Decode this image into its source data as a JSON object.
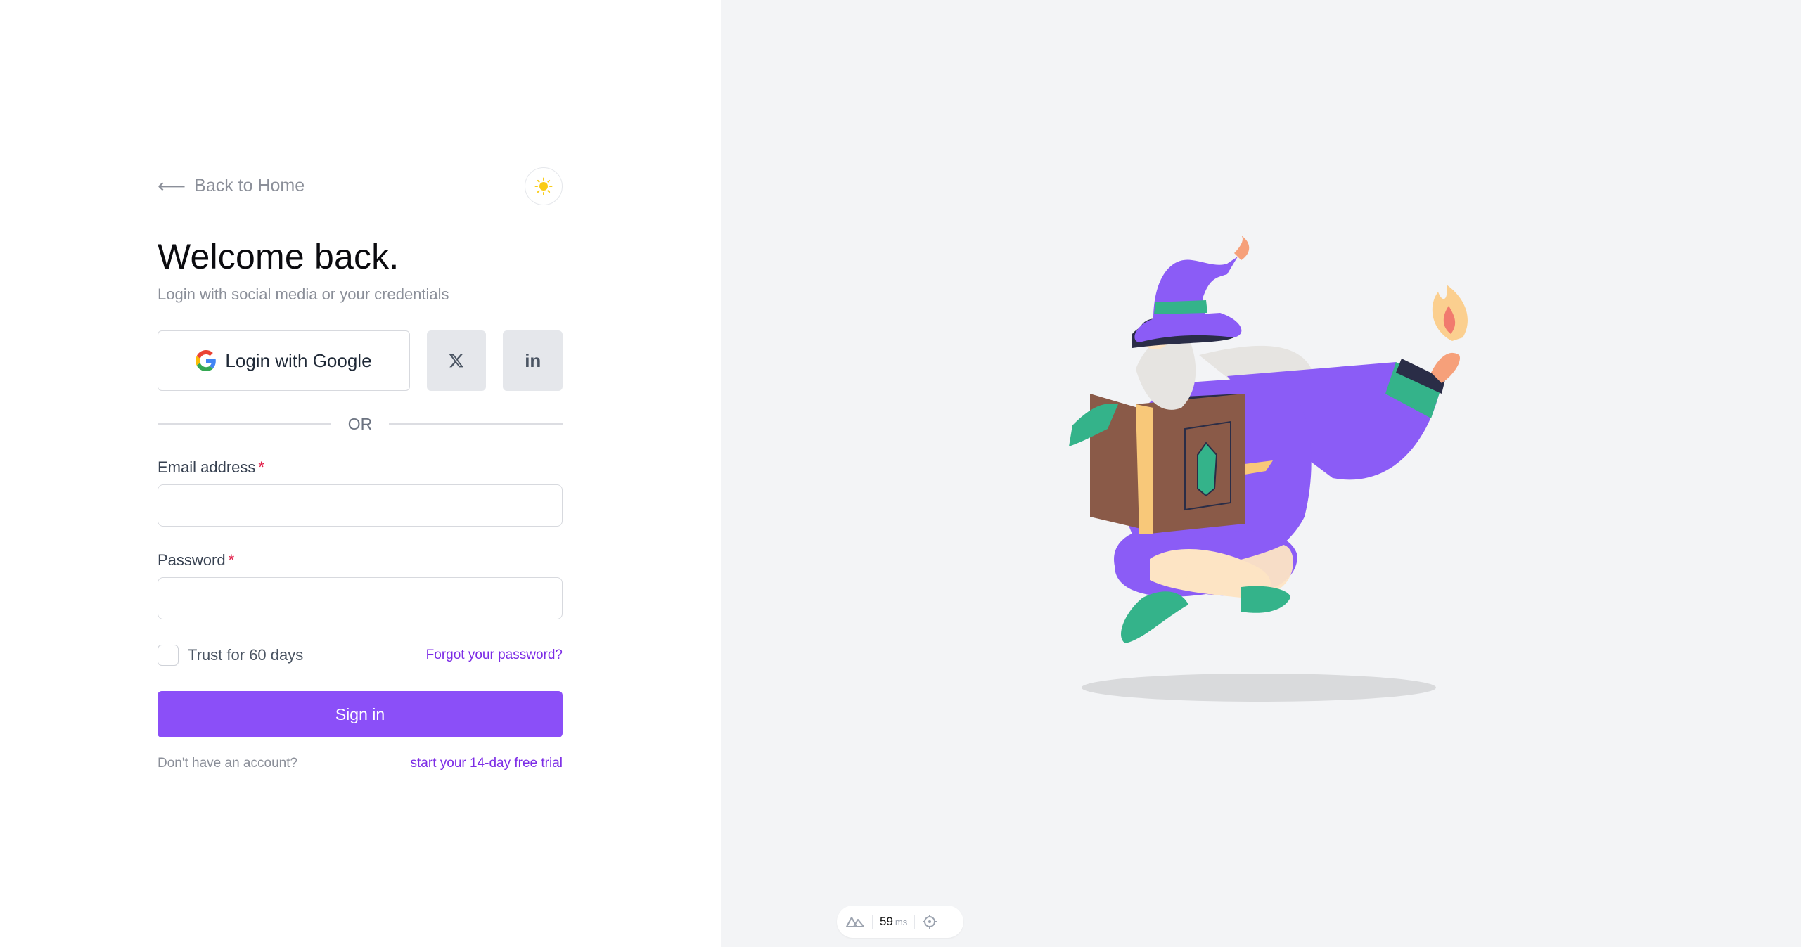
{
  "nav": {
    "back_label": "Back to Home"
  },
  "header": {
    "title": "Welcome back.",
    "subtitle": "Login with social media or your credentials"
  },
  "social": {
    "google_label": "Login with Google",
    "x_label": "X",
    "linkedin_label": "in"
  },
  "divider": {
    "or_text": "OR"
  },
  "form": {
    "email_label": "Email address",
    "password_label": "Password",
    "required_marker": "*",
    "email_value": "",
    "password_value": "",
    "trust_label": "Trust for 60 days",
    "trust_checked": false,
    "forgot_label": "Forgot your password?",
    "signin_label": "Sign in"
  },
  "footer": {
    "no_account_text": "Don't have an account?",
    "trial_link": "start your 14-day free trial"
  },
  "perf_badge": {
    "value": "59",
    "unit": "ms"
  },
  "icons": {
    "back": "arrow-left-icon",
    "theme": "sun-icon",
    "google": "google-icon",
    "x": "x-logo-icon",
    "linkedin": "linkedin-icon",
    "framework": "nuxt-logo-icon",
    "inspect": "crosshair-icon"
  },
  "colors": {
    "accent": "#8b4ff8",
    "link": "#7c2ce6",
    "required": "#e11d48",
    "panel_bg": "#f3f4f6"
  }
}
